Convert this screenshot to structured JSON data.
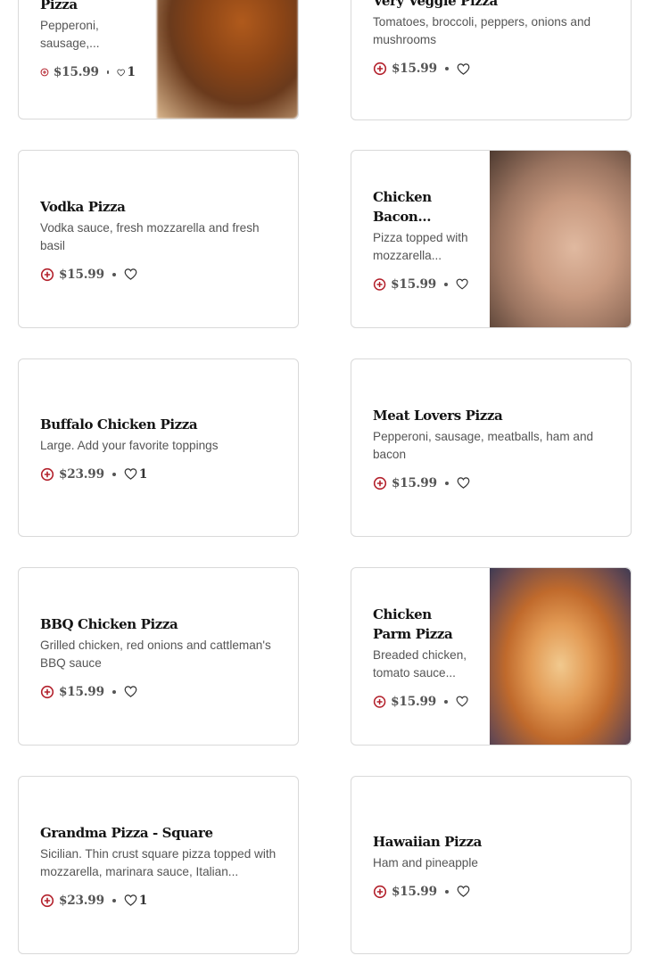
{
  "colors": {
    "accent": "#b3212c",
    "text": "#141414",
    "muted": "#555555",
    "border": "#d9d9d9"
  },
  "icons": {
    "add": "plus-circle-icon",
    "like": "heart-outline-icon"
  },
  "items": [
    {
      "name": "Pizza",
      "description": "Pepperoni, sausage,...",
      "price": "$15.99",
      "likes": "1"
    },
    {
      "name": "Very Veggie Pizza",
      "description": "Tomatoes, broccoli, peppers, onions and mushrooms",
      "price": "$15.99",
      "likes": ""
    },
    {
      "name": "Vodka Pizza",
      "description": "Vodka sauce, fresh mozzarella and fresh basil",
      "price": "$15.99",
      "likes": ""
    },
    {
      "name": "Chicken Bacon Ranc...",
      "description": "Pizza topped with mozzarella...",
      "price": "$15.99",
      "likes": ""
    },
    {
      "name": "Buffalo Chicken Pizza",
      "description": "Large. Add your favorite toppings",
      "price": "$23.99",
      "likes": "1"
    },
    {
      "name": "Meat Lovers Pizza",
      "description": "Pepperoni, sausage, meatballs, ham and bacon",
      "price": "$15.99",
      "likes": ""
    },
    {
      "name": "BBQ Chicken Pizza",
      "description": "Grilled chicken, red onions and cattleman's BBQ sauce",
      "price": "$15.99",
      "likes": ""
    },
    {
      "name": "Chicken Parm Pizza",
      "description": "Breaded chicken, tomato sauce...",
      "price": "$15.99",
      "likes": ""
    },
    {
      "name": "Grandma Pizza - Square",
      "description": "Sicilian. Thin crust square pizza topped with mozzarella, marinara sauce, Italian...",
      "price": "$23.99",
      "likes": "1"
    },
    {
      "name": "Hawaiian Pizza",
      "description": "Ham and pineapple",
      "price": "$15.99",
      "likes": ""
    }
  ]
}
